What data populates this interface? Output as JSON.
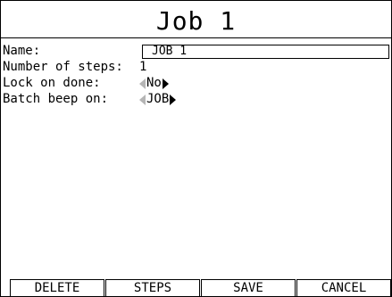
{
  "header": {
    "title": "Job 1"
  },
  "form": {
    "name_label": "Name:",
    "name_value": "JOB 1",
    "steps_label": "Number of steps:",
    "steps_value": "1",
    "lock_label": "Lock on done:",
    "lock_value": "No",
    "beep_label": "Batch beep on:",
    "beep_value": "JOB"
  },
  "buttons": {
    "delete": "DELETE",
    "steps": "STEPS",
    "save": "SAVE",
    "cancel": "CANCEL"
  },
  "icons": {
    "prev": "triangle-left-icon",
    "next": "triangle-right-icon"
  }
}
